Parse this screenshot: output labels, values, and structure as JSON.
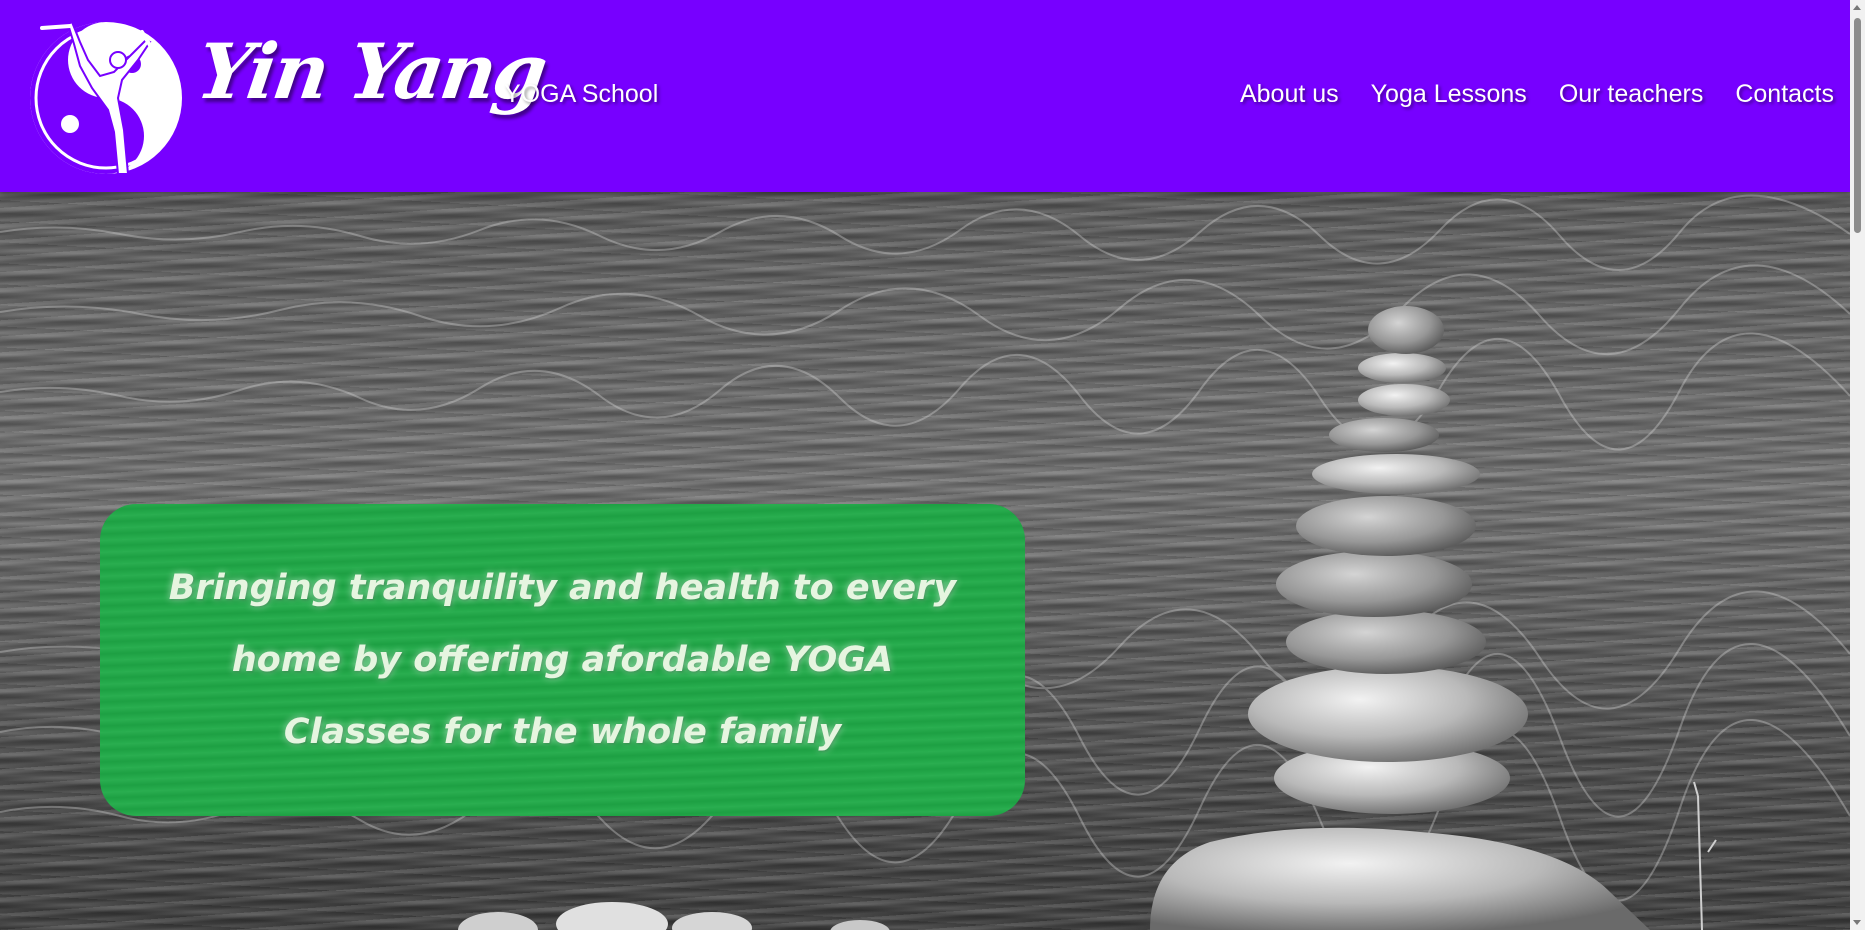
{
  "header": {
    "logo_text": "Yin Yang",
    "logo_subtitle": "YOGA School",
    "nav": [
      {
        "label": "About us"
      },
      {
        "label": "Yoga Lessons"
      },
      {
        "label": "Our teachers"
      },
      {
        "label": "Contacts"
      }
    ]
  },
  "hero": {
    "tagline": "Bringing tranquility and health to every home by offering afordable YOGA Classes for the whole family",
    "image": "stacked-stones-water-photo"
  },
  "colors": {
    "header_bg": "#7700ff",
    "tagline_box_bg": "#1faa47",
    "text": "#ffffff"
  },
  "icons": [
    "yoga-yin-yang-logo-icon",
    "scroll-up-arrow-icon",
    "scroll-down-arrow-icon"
  ]
}
